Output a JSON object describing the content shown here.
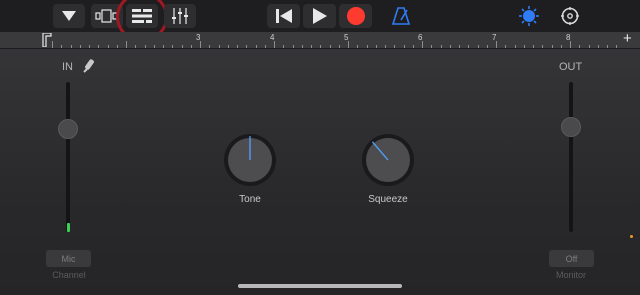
{
  "toolbar": {
    "buttons": [
      {
        "name": "dropdown-menu-icon"
      },
      {
        "name": "browser-view-icon"
      },
      {
        "name": "tracks-view-icon"
      },
      {
        "name": "mixer-icon"
      },
      {
        "name": "go-to-beginning-icon"
      },
      {
        "name": "play-icon"
      },
      {
        "name": "record-icon"
      },
      {
        "name": "metronome-icon"
      },
      {
        "name": "master-effects-icon"
      },
      {
        "name": "settings-gear-icon"
      }
    ],
    "record_color": "#ff3b30",
    "accent_color": "#2f7cf6"
  },
  "ruler": {
    "bars": [
      "3",
      "4",
      "5",
      "6",
      "7",
      "8"
    ],
    "add_label": "+"
  },
  "input": {
    "label": "IN",
    "button_label": "Mic",
    "caption": "Channel",
    "level": 0.06
  },
  "output": {
    "label": "OUT",
    "button_label": "Off",
    "caption": "Monitor"
  },
  "knobs": [
    {
      "label": "Tone",
      "value": 0.5
    },
    {
      "label": "Squeeze",
      "value": 0.35
    }
  ]
}
